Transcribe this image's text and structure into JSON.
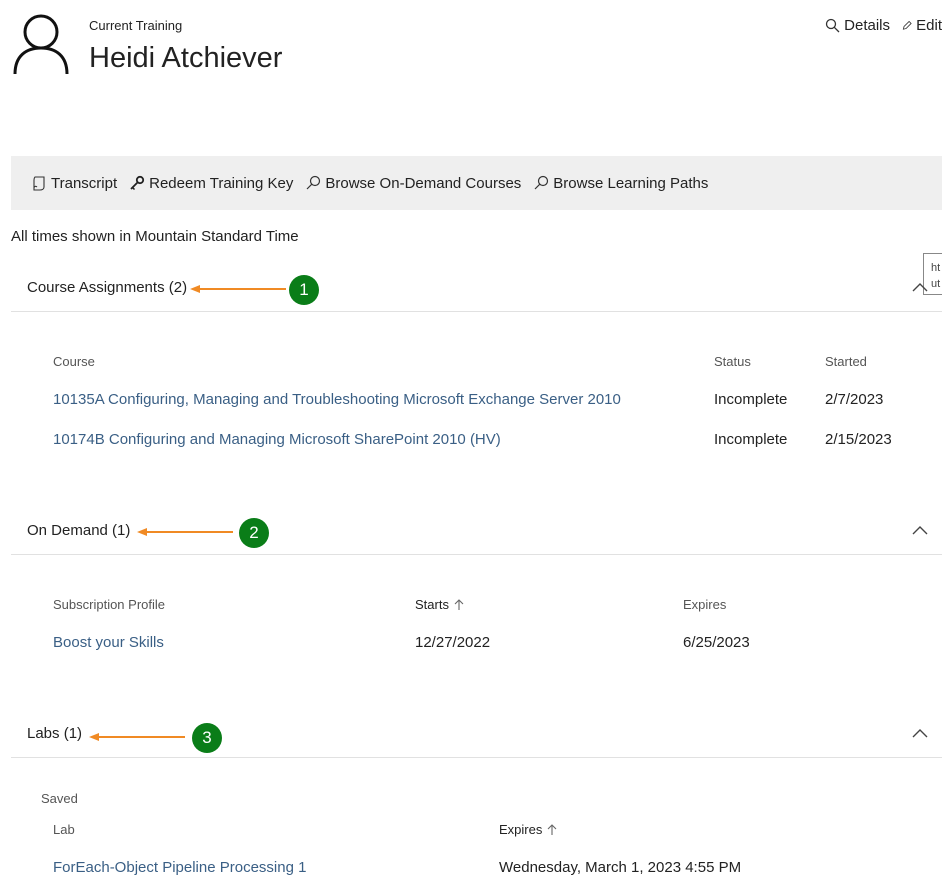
{
  "header": {
    "subtitle": "Current Training",
    "title": "Heidi Atchiever",
    "actions": {
      "details_label": "Details",
      "edit_label": "Edit"
    }
  },
  "toolbar": {
    "items": [
      {
        "label": "Transcript",
        "icon": "transcript-icon"
      },
      {
        "label": "Redeem Training Key",
        "icon": "key-icon"
      },
      {
        "label": "Browse On-Demand Courses",
        "icon": "search-icon"
      },
      {
        "label": "Browse Learning Paths",
        "icon": "search-icon"
      }
    ]
  },
  "timezone_note": "All times shown in Mountain Standard Time",
  "tooltip_fragment": {
    "line1": "ht",
    "line2": "ut"
  },
  "course_assignments": {
    "title": "Course Assignments (2)",
    "badge": "1",
    "columns": {
      "course": "Course",
      "status": "Status",
      "started": "Started"
    },
    "rows": [
      {
        "course": "10135A Configuring, Managing and Troubleshooting Microsoft Exchange Server 2010",
        "status": "Incomplete",
        "started": "2/7/2023"
      },
      {
        "course": "10174B Configuring and Managing Microsoft SharePoint 2010 (HV)",
        "status": "Incomplete",
        "started": "2/15/2023"
      }
    ]
  },
  "on_demand": {
    "title": "On Demand (1)",
    "badge": "2",
    "columns": {
      "profile": "Subscription Profile",
      "starts": "Starts",
      "expires": "Expires"
    },
    "rows": [
      {
        "profile": "Boost your Skills",
        "starts": "12/27/2022",
        "expires": "6/25/2023"
      }
    ]
  },
  "labs": {
    "title": "Labs (1)",
    "badge": "3",
    "saved_label": "Saved",
    "columns": {
      "lab": "Lab",
      "expires": "Expires"
    },
    "rows": [
      {
        "lab": "ForEach-Object Pipeline Processing 1",
        "expires": "Wednesday, March 1, 2023 4:55 PM"
      }
    ]
  },
  "colors": {
    "accent_link": "#3a5f85",
    "badge_green": "#0a7d18",
    "arrow_orange": "#f08a24",
    "toolbar_bg": "#efefef"
  }
}
